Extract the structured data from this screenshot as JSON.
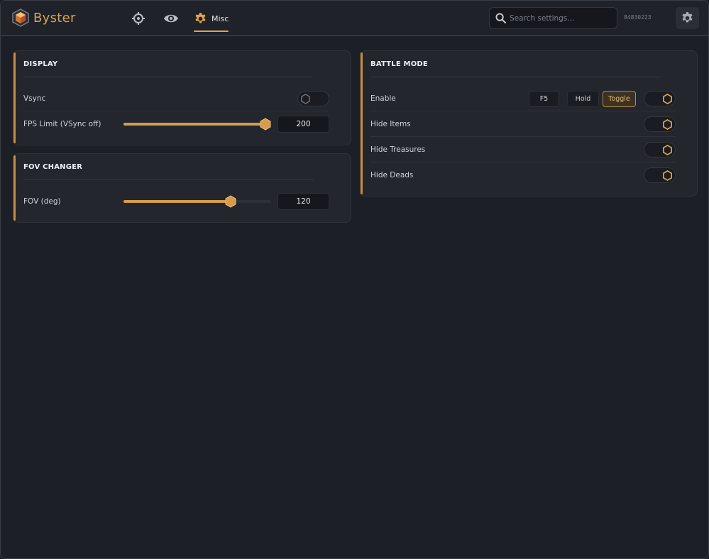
{
  "app": {
    "name": "Byster"
  },
  "nav": {
    "tabs": [
      {
        "icon": "crosshair-icon"
      },
      {
        "icon": "eye-icon"
      },
      {
        "icon": "gear-icon",
        "label": "Misc",
        "active": true
      }
    ]
  },
  "search": {
    "placeholder": "Search settings..."
  },
  "user": {
    "id": "84830223"
  },
  "display": {
    "title": "DISPLAY",
    "vsync": {
      "label": "Vsync",
      "on": false
    },
    "fps": {
      "label": "FPS Limit (VSync off)",
      "value": "200",
      "fill": 1.0
    }
  },
  "fov": {
    "title": "FOV CHANGER",
    "fov": {
      "label": "FOV (deg)",
      "value": "120",
      "fill": 0.73
    }
  },
  "battle": {
    "title": "BATTLE MODE",
    "enable": {
      "label": "Enable",
      "key": "F5",
      "hold": "Hold",
      "toggle": "Toggle",
      "mode": "Toggle",
      "on": true
    },
    "hide_items": {
      "label": "Hide Items",
      "on": true
    },
    "hide_treasures": {
      "label": "Hide Treasures",
      "on": true
    },
    "hide_deads": {
      "label": "Hide Deads",
      "on": true
    }
  },
  "colors": {
    "accent": "#d69b4c",
    "background": "#1c1f26",
    "panel": "#23262d"
  }
}
